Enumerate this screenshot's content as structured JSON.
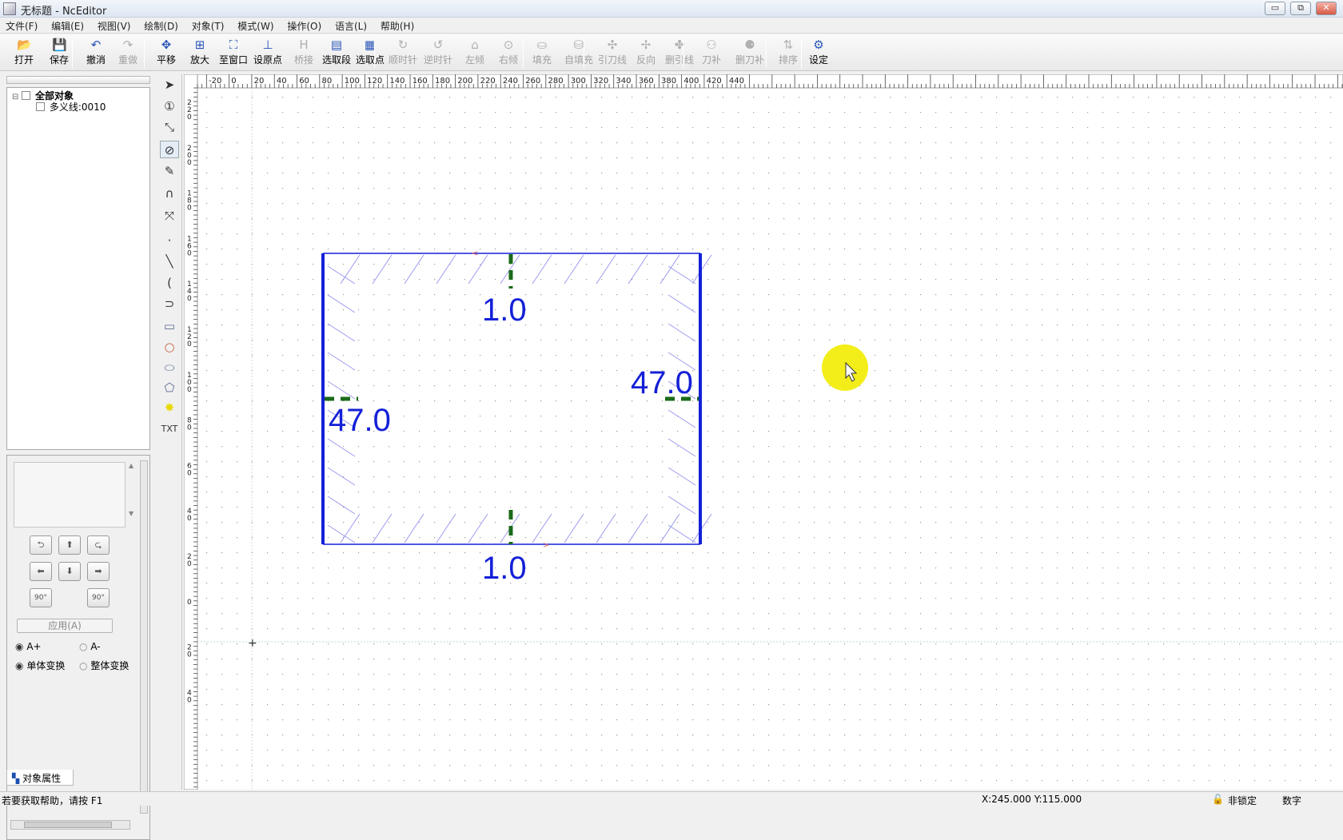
{
  "window": {
    "title": "无标题 - NcEditor",
    "buttons": [
      "▭",
      "⧉",
      "✕"
    ]
  },
  "menu": [
    "文件(F)",
    "编辑(E)",
    "视图(V)",
    "绘制(D)",
    "对象(T)",
    "模式(W)",
    "操作(O)",
    "语言(L)",
    "帮助(H)"
  ],
  "toolbar": [
    {
      "label": "打开",
      "icon": "open-folder-icon",
      "glyph": "📂",
      "enabled": true
    },
    {
      "label": "保存",
      "icon": "save-icon",
      "glyph": "💾",
      "enabled": true
    },
    {
      "label": "撤消",
      "icon": "undo-icon",
      "glyph": "↶",
      "enabled": true
    },
    {
      "label": "重做",
      "icon": "redo-icon",
      "glyph": "↷",
      "enabled": false
    },
    {
      "label": "平移",
      "icon": "pan-icon",
      "glyph": "✥",
      "enabled": true
    },
    {
      "label": "放大",
      "icon": "zoom-in-icon",
      "glyph": "⊞",
      "enabled": true
    },
    {
      "label": "至窗口",
      "icon": "fit-window-icon",
      "glyph": "⛶",
      "enabled": true
    },
    {
      "label": "设原点",
      "icon": "set-origin-icon",
      "glyph": "⊥",
      "enabled": true
    },
    {
      "label": "桥接",
      "icon": "bridge-icon",
      "glyph": "H",
      "enabled": false
    },
    {
      "label": "选取段",
      "icon": "select-segment-icon",
      "glyph": "▤",
      "enabled": true
    },
    {
      "label": "选取点",
      "icon": "select-point-icon",
      "glyph": "▦",
      "enabled": true
    },
    {
      "label": "顺时针",
      "icon": "clockwise-icon",
      "glyph": "↻",
      "enabled": false
    },
    {
      "label": "逆时针",
      "icon": "counterclockwise-icon",
      "glyph": "↺",
      "enabled": false
    },
    {
      "label": "左倾",
      "icon": "lean-left-icon",
      "glyph": "⌂",
      "enabled": false
    },
    {
      "label": "右倾",
      "icon": "lean-right-icon",
      "glyph": "⊙",
      "enabled": false
    },
    {
      "label": "填充",
      "icon": "fill-icon",
      "glyph": "⛀",
      "enabled": false
    },
    {
      "label": "自填充",
      "icon": "auto-fill-icon",
      "glyph": "⛁",
      "enabled": false
    },
    {
      "label": "引刀线",
      "icon": "lead-line-icon",
      "glyph": "✣",
      "enabled": false
    },
    {
      "label": "反向",
      "icon": "reverse-icon",
      "glyph": "✢",
      "enabled": false
    },
    {
      "label": "删引线",
      "icon": "delete-lead-icon",
      "glyph": "✤",
      "enabled": false
    },
    {
      "label": "刀补",
      "icon": "tool-comp-icon",
      "glyph": "⚇",
      "enabled": false
    },
    {
      "label": "删刀补",
      "icon": "delete-comp-icon",
      "glyph": "⚈",
      "enabled": false
    },
    {
      "label": "排序",
      "icon": "sort-icon",
      "glyph": "⇅",
      "enabled": false
    },
    {
      "label": "设定",
      "icon": "settings-gear-icon",
      "glyph": "⚙",
      "enabled": true
    }
  ],
  "tree": {
    "root": "全部对象",
    "child": "多义线:0010"
  },
  "properties": {
    "apply_label": "应用(A)",
    "radio_a_plus": "A+",
    "radio_a_minus": "A-",
    "radio_single": "单体变换",
    "radio_whole": "整体变换",
    "tab_label": "对象属性",
    "rotate_labels": [
      "90°",
      "90°"
    ]
  },
  "left_tools": [
    {
      "name": "select-arrow-icon",
      "glyph": "➤"
    },
    {
      "name": "number-one-icon",
      "glyph": "①"
    },
    {
      "name": "node-edit-icon",
      "glyph": "⤡"
    },
    {
      "name": "circle-pointer-icon",
      "glyph": "⊘"
    },
    {
      "name": "pencil-icon",
      "glyph": "✎"
    },
    {
      "name": "magnet-icon",
      "glyph": "∩"
    },
    {
      "name": "transform-icon",
      "glyph": "⤧"
    },
    {
      "name": "point-icon",
      "glyph": "·"
    },
    {
      "name": "line-icon",
      "glyph": "╲"
    },
    {
      "name": "arc-icon",
      "glyph": "("
    },
    {
      "name": "polyline-icon",
      "glyph": "⊃"
    },
    {
      "name": "rectangle-icon",
      "glyph": "▭"
    },
    {
      "name": "circle-icon",
      "glyph": "○"
    },
    {
      "name": "ellipse-icon",
      "glyph": "⬭"
    },
    {
      "name": "polygon-icon",
      "glyph": "⬠"
    },
    {
      "name": "star-icon",
      "glyph": "✸"
    },
    {
      "name": "text-icon",
      "glyph": "TXT"
    }
  ],
  "ruler": {
    "top": [
      "-20",
      "0",
      "20",
      "40",
      "60",
      "80",
      "100",
      "120",
      "140",
      "160",
      "180",
      "200",
      "220",
      "240",
      "260",
      "280",
      "300",
      "320",
      "340",
      "360",
      "380",
      "400",
      "420",
      "440"
    ],
    "left": [
      "220",
      "200",
      "180",
      "160",
      "140",
      "120",
      "100",
      "80",
      "60",
      "40",
      "20",
      "0",
      "20",
      "40"
    ]
  },
  "drawing": {
    "dims": [
      "1.0",
      "1.0",
      "47.0",
      "47.0"
    ],
    "stroke_color": "#1420d8",
    "marker_color": "#1a6a1a",
    "hatch_color": "#8080e8"
  },
  "status": {
    "help": "若要获取帮助，请按 F1",
    "coords": "X:245.000  Y:115.000",
    "lock": "非锁定",
    "mode": "数字"
  }
}
